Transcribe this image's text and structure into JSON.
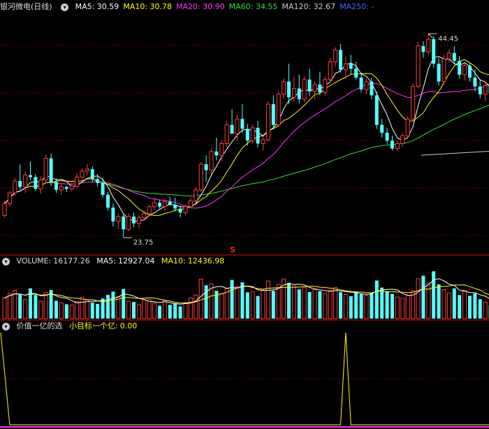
{
  "colors": {
    "up": "#ff3c3c",
    "down": "#54ffff",
    "grid": "#7a0000",
    "border": "#a00000",
    "ma5": "#ffffff",
    "ma10": "#ffff00",
    "ma20": "#ff33ff",
    "ma60": "#33dd33",
    "ma120": "#cccccc",
    "ma250": "#4466ff",
    "label": "#dddddd"
  },
  "price_panel": {
    "stock_name": "银河微电",
    "period": "(日线)",
    "ma_items": [
      {
        "label": "MA5:",
        "value": "30.59",
        "key": "ma5"
      },
      {
        "label": "MA10:",
        "value": "30.78",
        "key": "ma10"
      },
      {
        "label": "MA20:",
        "value": "30.90",
        "key": "ma20"
      },
      {
        "label": "MA60:",
        "value": "34.55",
        "key": "ma60"
      },
      {
        "label": "MA120:",
        "value": "32.67",
        "key": "ma120"
      },
      {
        "label": "MA250:",
        "value": "-",
        "key": "ma250"
      }
    ],
    "high_label": "44.45",
    "low_label": "23.75",
    "marker": "S"
  },
  "volume_panel": {
    "title": "VOLUME:",
    "value": "16177.26",
    "ma5_label": "MA5:",
    "ma5_value": "12927.04",
    "ma10_label": "MA10:",
    "ma10_value": "12436.98"
  },
  "indicator_panel": {
    "name": "价值一亿的选",
    "line_label": "小目标一个亿:",
    "line_value": "0.00"
  },
  "chart_data": {
    "type": "candlestick",
    "price_range": [
      22.2,
      46.6
    ],
    "volume_range": [
      0,
      27000
    ],
    "indicator_range": [
      0,
      1
    ],
    "highest": 44.45,
    "lowest": 23.75,
    "ohlc": [
      [
        26.0,
        27.5,
        25.8,
        27.2
      ],
      [
        27.2,
        28.5,
        26.9,
        28.3
      ],
      [
        28.3,
        29.8,
        28.0,
        29.5
      ],
      [
        29.5,
        31.2,
        28.6,
        28.9
      ],
      [
        28.9,
        30.5,
        28.3,
        30.1
      ],
      [
        30.1,
        31.5,
        29.6,
        29.9
      ],
      [
        29.9,
        30.2,
        28.5,
        28.7
      ],
      [
        28.7,
        30.0,
        28.2,
        29.6
      ],
      [
        29.6,
        32.2,
        29.3,
        31.8
      ],
      [
        31.8,
        32.3,
        29.0,
        29.4
      ],
      [
        29.4,
        29.8,
        28.3,
        28.6
      ],
      [
        28.6,
        29.2,
        28.1,
        28.9
      ],
      [
        28.9,
        29.0,
        28.4,
        28.7
      ],
      [
        28.7,
        29.3,
        28.5,
        29.0
      ],
      [
        29.0,
        30.3,
        28.8,
        29.9
      ],
      [
        29.9,
        30.8,
        29.6,
        30.5
      ],
      [
        30.5,
        31.2,
        30.1,
        30.7
      ],
      [
        30.7,
        31.0,
        29.4,
        29.7
      ],
      [
        29.7,
        30.2,
        28.9,
        29.3
      ],
      [
        29.3,
        29.8,
        27.8,
        28.1
      ],
      [
        28.1,
        28.4,
        26.5,
        26.8
      ],
      [
        26.8,
        27.2,
        24.9,
        25.4
      ],
      [
        25.4,
        26.2,
        24.6,
        25.9
      ],
      [
        25.9,
        26.1,
        23.75,
        24.6
      ],
      [
        24.6,
        26.2,
        24.4,
        25.9
      ],
      [
        25.9,
        26.3,
        24.8,
        25.2
      ],
      [
        25.2,
        26.0,
        24.7,
        25.8
      ],
      [
        25.8,
        26.5,
        25.5,
        26.2
      ],
      [
        26.2,
        27.1,
        26.0,
        26.9
      ],
      [
        26.9,
        27.8,
        26.6,
        27.3
      ],
      [
        27.3,
        27.6,
        26.7,
        26.9
      ],
      [
        26.9,
        27.7,
        26.5,
        27.4
      ],
      [
        27.4,
        27.9,
        27.0,
        27.1
      ],
      [
        27.1,
        27.8,
        26.4,
        26.7
      ],
      [
        26.7,
        27.0,
        25.8,
        26.3
      ],
      [
        26.3,
        27.1,
        26.0,
        26.9
      ],
      [
        26.9,
        27.8,
        26.7,
        27.5
      ],
      [
        27.5,
        28.9,
        27.3,
        28.6
      ],
      [
        28.6,
        31.4,
        28.4,
        31.2
      ],
      [
        31.2,
        32.1,
        29.4,
        30.6
      ],
      [
        30.6,
        32.8,
        30.2,
        32.5
      ],
      [
        32.5,
        33.9,
        31.6,
        32.1
      ],
      [
        32.1,
        33.6,
        31.5,
        33.3
      ],
      [
        33.3,
        35.6,
        32.9,
        35.2
      ],
      [
        35.2,
        36.8,
        34.9,
        34.3
      ],
      [
        34.3,
        36.2,
        33.6,
        35.8
      ],
      [
        35.8,
        37.3,
        34.4,
        34.8
      ],
      [
        34.8,
        35.3,
        33.1,
        33.6
      ],
      [
        33.6,
        35.2,
        33.3,
        34.9
      ],
      [
        34.9,
        35.6,
        32.9,
        33.3
      ],
      [
        33.3,
        34.0,
        32.6,
        33.7
      ],
      [
        33.7,
        37.6,
        33.5,
        37.3
      ],
      [
        37.3,
        38.2,
        34.8,
        35.2
      ],
      [
        35.2,
        38.6,
        35.0,
        38.3
      ],
      [
        38.3,
        39.9,
        37.8,
        39.6
      ],
      [
        39.6,
        41.4,
        37.3,
        38.0
      ],
      [
        38.0,
        40.1,
        37.6,
        38.9
      ],
      [
        38.9,
        40.3,
        37.4,
        37.8
      ],
      [
        37.8,
        40.1,
        37.5,
        39.8
      ],
      [
        39.8,
        40.9,
        38.1,
        38.6
      ],
      [
        38.6,
        39.6,
        37.8,
        39.3
      ],
      [
        39.3,
        40.6,
        38.2,
        38.5
      ],
      [
        38.5,
        40.1,
        38.2,
        39.8
      ],
      [
        39.8,
        42.0,
        39.5,
        41.6
      ],
      [
        41.6,
        43.1,
        41.1,
        42.8
      ],
      [
        42.8,
        43.4,
        40.5,
        40.8
      ],
      [
        40.8,
        42.1,
        39.9,
        41.4
      ],
      [
        41.4,
        42.3,
        40.4,
        40.9
      ],
      [
        40.9,
        41.6,
        39.8,
        40.0
      ],
      [
        40.0,
        40.5,
        38.5,
        38.8
      ],
      [
        38.8,
        39.9,
        38.3,
        39.6
      ],
      [
        39.6,
        40.0,
        37.8,
        38.2
      ],
      [
        38.2,
        38.6,
        34.8,
        35.2
      ],
      [
        35.2,
        35.8,
        33.9,
        34.4
      ],
      [
        34.4,
        34.9,
        33.3,
        33.6
      ],
      [
        33.6,
        34.1,
        32.6,
        32.8
      ],
      [
        32.8,
        33.6,
        32.5,
        33.3
      ],
      [
        33.3,
        34.4,
        33.0,
        34.1
      ],
      [
        34.1,
        36.1,
        33.8,
        35.8
      ],
      [
        35.8,
        39.4,
        35.6,
        39.1
      ],
      [
        39.1,
        43.6,
        38.9,
        43.2
      ],
      [
        43.2,
        43.7,
        42.0,
        42.6
      ],
      [
        42.6,
        44.45,
        42.3,
        43.9
      ],
      [
        43.9,
        44.2,
        41.0,
        41.4
      ],
      [
        41.4,
        42.0,
        39.2,
        39.6
      ],
      [
        39.6,
        42.3,
        39.3,
        41.9
      ],
      [
        41.9,
        42.9,
        41.5,
        42.5
      ],
      [
        42.5,
        43.2,
        41.3,
        41.7
      ],
      [
        41.7,
        42.2,
        39.9,
        40.3
      ],
      [
        40.3,
        41.6,
        39.7,
        41.2
      ],
      [
        41.2,
        41.5,
        39.6,
        40.0
      ],
      [
        40.0,
        40.8,
        38.6,
        39.1
      ],
      [
        39.1,
        39.8,
        37.9,
        38.3
      ],
      [
        38.3,
        39.6,
        37.6,
        39.2
      ],
      [
        39.2,
        39.9,
        38.0,
        38.4
      ]
    ],
    "volume": [
      10800,
      13200,
      14700,
      12500,
      9900,
      15800,
      12300,
      9100,
      13600,
      14900,
      9300,
      8200,
      7500,
      7100,
      8900,
      11200,
      9600,
      8400,
      7700,
      10500,
      12400,
      14100,
      11600,
      15500,
      9200,
      8700,
      7300,
      9800,
      10100,
      8100,
      6700,
      9400,
      7200,
      7900,
      6400,
      8300,
      10800,
      12300,
      20600,
      17400,
      18300,
      14500,
      13100,
      15700,
      20200,
      16600,
      18900,
      13700,
      14100,
      11800,
      14900,
      19600,
      14500,
      17800,
      20700,
      18700,
      17100,
      15200,
      16400,
      13900,
      15100,
      14300,
      13200,
      14600,
      16300,
      13800,
      12600,
      11700,
      14100,
      12800,
      12200,
      13500,
      19900,
      16200,
      14300,
      12900,
      11300,
      10600,
      12100,
      14400,
      20800,
      22400,
      18600,
      24700,
      17900,
      15100,
      13400,
      15800,
      12300,
      14800,
      11900,
      13200,
      10100,
      8500,
      7000
    ],
    "ma_values": [
      {
        "name": "MA5",
        "value": 30.59
      },
      {
        "name": "MA10",
        "value": 30.78
      },
      {
        "name": "MA20",
        "value": 30.9
      },
      {
        "name": "MA60",
        "value": 34.55
      },
      {
        "name": "MA120",
        "value": 32.67
      }
    ],
    "volume_ma": [
      {
        "name": "MA5",
        "value": 12927.04
      },
      {
        "name": "MA10",
        "value": 12436.98
      }
    ],
    "indicator_spikes": [
      {
        "index": 66,
        "value": 1.0
      }
    ],
    "indicator_start_value": 1.0,
    "sell_marker_index": 44,
    "grid": true
  }
}
